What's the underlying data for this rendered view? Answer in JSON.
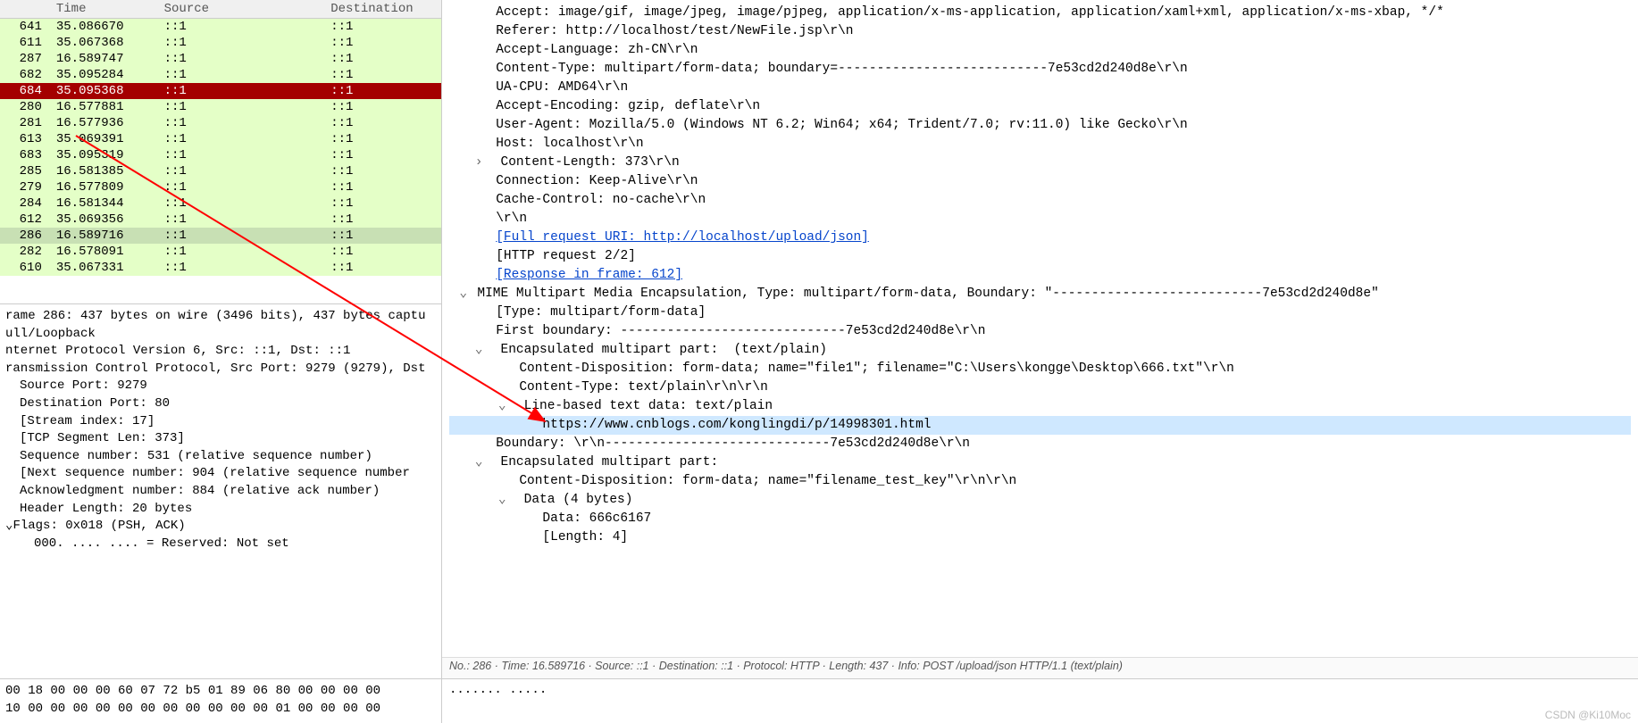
{
  "columns": {
    "no": "",
    "time": "Time",
    "src": "Source",
    "dst": "Destination"
  },
  "rows": [
    {
      "no": "641",
      "time": "35.086670",
      "src": "::1",
      "dst": "::1",
      "cls": "row-green"
    },
    {
      "no": "611",
      "time": "35.067368",
      "src": "::1",
      "dst": "::1",
      "cls": "row-green"
    },
    {
      "no": "287",
      "time": "16.589747",
      "src": "::1",
      "dst": "::1",
      "cls": "row-green"
    },
    {
      "no": "682",
      "time": "35.095284",
      "src": "::1",
      "dst": "::1",
      "cls": "row-green"
    },
    {
      "no": "684",
      "time": "35.095368",
      "src": "::1",
      "dst": "::1",
      "cls": "row-red"
    },
    {
      "no": "280",
      "time": "16.577881",
      "src": "::1",
      "dst": "::1",
      "cls": "row-green"
    },
    {
      "no": "281",
      "time": "16.577936",
      "src": "::1",
      "dst": "::1",
      "cls": "row-green"
    },
    {
      "no": "613",
      "time": "35.069391",
      "src": "::1",
      "dst": "::1",
      "cls": "row-green"
    },
    {
      "no": "683",
      "time": "35.095319",
      "src": "::1",
      "dst": "::1",
      "cls": "row-green"
    },
    {
      "no": "285",
      "time": "16.581385",
      "src": "::1",
      "dst": "::1",
      "cls": "row-green"
    },
    {
      "no": "279",
      "time": "16.577809",
      "src": "::1",
      "dst": "::1",
      "cls": "row-green"
    },
    {
      "no": "284",
      "time": "16.581344",
      "src": "::1",
      "dst": "::1",
      "cls": "row-green"
    },
    {
      "no": "612",
      "time": "35.069356",
      "src": "::1",
      "dst": "::1",
      "cls": "row-green"
    },
    {
      "no": "286",
      "time": "16.589716",
      "src": "::1",
      "dst": "::1",
      "cls": "row-hover"
    },
    {
      "no": "282",
      "time": "16.578091",
      "src": "::1",
      "dst": "::1",
      "cls": "row-green"
    },
    {
      "no": "610",
      "time": "35.067331",
      "src": "::1",
      "dst": "::1",
      "cls": "row-green"
    }
  ],
  "frame": {
    "summary": "rame 286: 437 bytes on wire (3496 bits), 437 bytes captu",
    "loop": "ull/Loopback",
    "ipv6": "nternet Protocol Version 6, Src: ::1, Dst: ::1",
    "tcp": "ransmission Control Protocol, Src Port: 9279 (9279), Dst",
    "srcport": "Source Port: 9279",
    "dstport": "Destination Port: 80",
    "stream": "[Stream index: 17]",
    "seglen": "[TCP Segment Len: 373]",
    "seq": "Sequence number: 531    (relative sequence number)",
    "nextseq": "[Next sequence number: 904    (relative sequence number",
    "ack": "Acknowledgment number: 884    (relative ack number)",
    "hlen": "Header Length: 20 bytes",
    "flags": "Flags: 0x018 (PSH, ACK)",
    "reserved": "000. .... .... = Reserved: Not set"
  },
  "hex": {
    "l0": "00  18 00 00 00 60 07 72 b5  01 89 06 80 00 00 00 00",
    "l1": "10  00 00 00 00 00 00 00 00  00 00 00 01 00 00 00 00"
  },
  "http": {
    "accept": "Accept: image/gif, image/jpeg, image/pjpeg, application/x-ms-application, application/xaml+xml, application/x-ms-xbap, */*",
    "referer": "Referer: http://localhost/test/NewFile.jsp\\r\\n",
    "acclang": "Accept-Language: zh-CN\\r\\n",
    "ctype": "Content-Type: multipart/form-data; boundary=---------------------------7e53cd2d240d8e\\r\\n",
    "uacpu": "UA-CPU: AMD64\\r\\n",
    "accenc": "Accept-Encoding: gzip, deflate\\r\\n",
    "ua": "User-Agent: Mozilla/5.0 (Windows NT 6.2; Win64; x64; Trident/7.0; rv:11.0) like Gecko\\r\\n",
    "host": "Host: localhost\\r\\n",
    "clen": "Content-Length: 373\\r\\n",
    "conn": "Connection: Keep-Alive\\r\\n",
    "cache": "Cache-Control: no-cache\\r\\n",
    "crlf": "\\r\\n",
    "fulluri": "[Full request URI: http://localhost/upload/json]",
    "req22": "[HTTP request 2/2]",
    "respframe": "[Response in frame: 612]",
    "mime": "MIME Multipart Media Encapsulation, Type: multipart/form-data, Boundary: \"---------------------------7e53cd2d240d8e\"",
    "mimetype": "[Type: multipart/form-data]",
    "firstb": "First boundary: -----------------------------7e53cd2d240d8e\\r\\n",
    "encap1": "Encapsulated multipart part:  (text/plain)",
    "cd1": "Content-Disposition: form-data; name=\"file1\"; filename=\"C:\\Users\\kongge\\Desktop\\666.txt\"\\r\\n",
    "ct1": "Content-Type: text/plain\\r\\n\\r\\n",
    "lbtd": "Line-based text data: text/plain",
    "url": "https://www.cnblogs.com/konglingdi/p/14998301.html",
    "bound2": "Boundary: \\r\\n-----------------------------7e53cd2d240d8e\\r\\n",
    "encap2": "Encapsulated multipart part:",
    "cd2": "Content-Disposition: form-data; name=\"filename_test_key\"\\r\\n\\r\\n",
    "data4": "Data (4 bytes)",
    "datahex": "Data: 666c6167",
    "datalen": "[Length: 4]"
  },
  "status": "No.: 286 · Time: 16.589716 · Source: ::1 · Destination: ::1 · Protocol: HTTP · Length: 437 · Info: POST /upload/json HTTP/1.1  (text/plain)",
  "rhex": "....... .....",
  "watermark": "CSDN @Ki10Moc"
}
